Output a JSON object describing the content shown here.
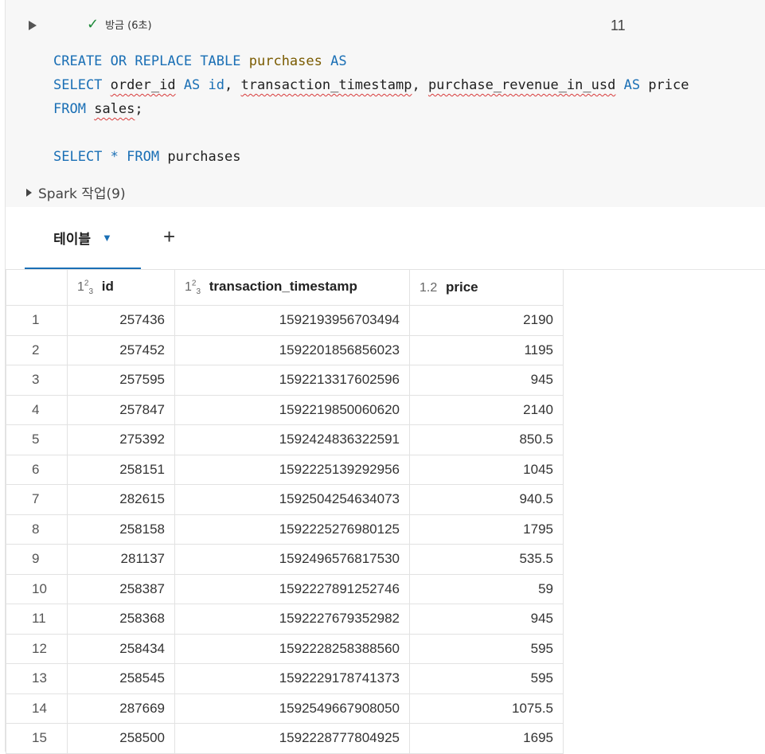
{
  "cell": {
    "status": "방금 (6초)",
    "number": "11",
    "code": [
      [
        {
          "t": "CREATE",
          "c": "kw"
        },
        {
          "t": " "
        },
        {
          "t": "OR",
          "c": "kw"
        },
        {
          "t": " "
        },
        {
          "t": "REPLACE",
          "c": "kw"
        },
        {
          "t": " "
        },
        {
          "t": "TABLE",
          "c": "kw"
        },
        {
          "t": " "
        },
        {
          "t": "purchases",
          "c": "fn"
        },
        {
          "t": " "
        },
        {
          "t": "AS",
          "c": "kw"
        }
      ],
      [
        {
          "t": "SELECT",
          "c": "kw"
        },
        {
          "t": " "
        },
        {
          "t": "order_id",
          "c": "sq"
        },
        {
          "t": " "
        },
        {
          "t": "AS",
          "c": "kw"
        },
        {
          "t": " "
        },
        {
          "t": "id",
          "c": "kw"
        },
        {
          "t": ", "
        },
        {
          "t": "transaction_timestamp",
          "c": "sq"
        },
        {
          "t": ", "
        },
        {
          "t": "purchase_revenue_in_usd",
          "c": "sq"
        },
        {
          "t": " "
        },
        {
          "t": "AS",
          "c": "kw"
        },
        {
          "t": " price"
        }
      ],
      [
        {
          "t": "FROM",
          "c": "kw"
        },
        {
          "t": " "
        },
        {
          "t": "sales",
          "c": "sq"
        },
        {
          "t": ";"
        }
      ],
      [],
      [
        {
          "t": "SELECT",
          "c": "kw"
        },
        {
          "t": " "
        },
        {
          "t": "*",
          "c": "kw"
        },
        {
          "t": " "
        },
        {
          "t": "FROM",
          "c": "kw"
        },
        {
          "t": " purchases"
        }
      ]
    ],
    "spark_jobs": "Spark 작업(9)"
  },
  "results": {
    "tab_label": "테이블",
    "add_tab": "+",
    "columns": [
      {
        "type_icon": "123-icon",
        "name": "id"
      },
      {
        "type_icon": "123-icon",
        "name": "transaction_timestamp"
      },
      {
        "type_icon": "1.2",
        "name": "price"
      }
    ],
    "rows": [
      [
        "1",
        "257436",
        "1592193956703494",
        "2190"
      ],
      [
        "2",
        "257452",
        "1592201856856023",
        "1195"
      ],
      [
        "3",
        "257595",
        "1592213317602596",
        "945"
      ],
      [
        "4",
        "257847",
        "1592219850060620",
        "2140"
      ],
      [
        "5",
        "275392",
        "1592424836322591",
        "850.5"
      ],
      [
        "6",
        "258151",
        "1592225139292956",
        "1045"
      ],
      [
        "7",
        "282615",
        "1592504254634073",
        "940.5"
      ],
      [
        "8",
        "258158",
        "1592225276980125",
        "1795"
      ],
      [
        "9",
        "281137",
        "1592496576817530",
        "535.5"
      ],
      [
        "10",
        "258387",
        "1592227891252746",
        "59"
      ],
      [
        "11",
        "258368",
        "1592227679352982",
        "945"
      ],
      [
        "12",
        "258434",
        "1592228258388560",
        "595"
      ],
      [
        "13",
        "258545",
        "1592229178741373",
        "595"
      ],
      [
        "14",
        "287669",
        "1592549667908050",
        "1075.5"
      ],
      [
        "15",
        "258500",
        "1592228777804925",
        "1695"
      ]
    ]
  }
}
